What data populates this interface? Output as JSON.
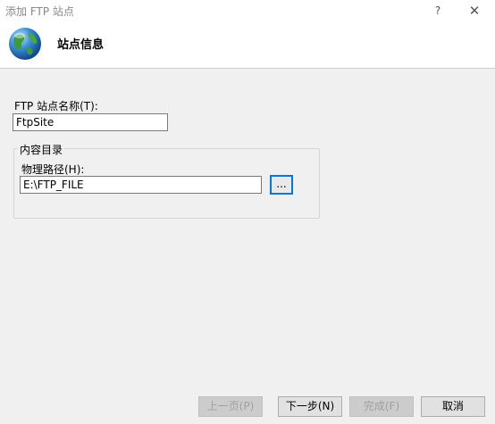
{
  "window": {
    "title": "添加 FTP 站点",
    "help": "?",
    "close": "✕"
  },
  "header": {
    "title": "站点信息",
    "icon": "globe-icon"
  },
  "form": {
    "site_name_label": "FTP 站点名称(T):",
    "site_name_value": "FtpSite",
    "content_group_label": "内容目录",
    "physical_path_label": "物理路径(H):",
    "physical_path_value": "E:\\FTP_FILE",
    "browse_label": "..."
  },
  "footer": {
    "prev": "上一页(P)",
    "next": "下一步(N)",
    "finish": "完成(F)",
    "cancel": "取消"
  }
}
